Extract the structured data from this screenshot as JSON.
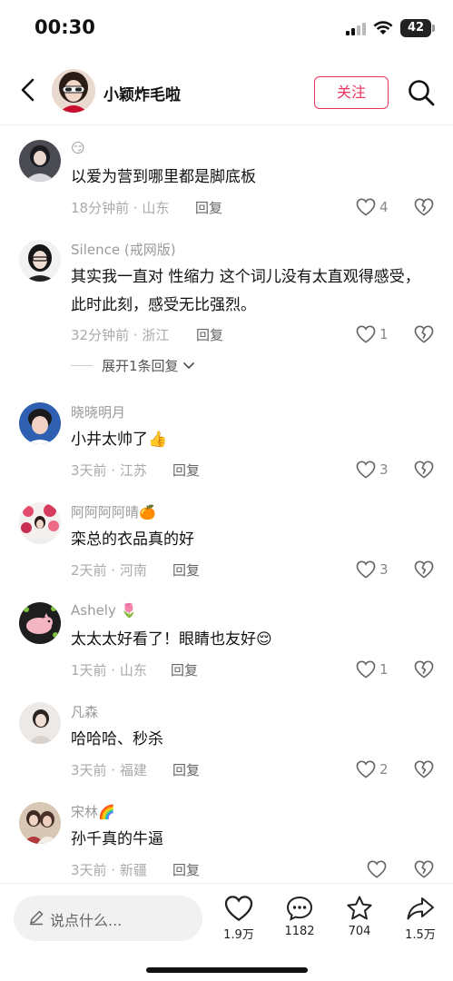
{
  "status_bar": {
    "time": "00:30",
    "battery": "42"
  },
  "header": {
    "user_name": "小颖炸毛啦",
    "follow_label": "关注"
  },
  "comments": [
    {
      "name": "",
      "name_emoji": "😏",
      "text": "以爱为营到哪里都是脚底板",
      "meta": "18分钟前 · 山东",
      "reply": "回复",
      "likes": "4"
    },
    {
      "name": "Silence (戒网版)",
      "text": "其实我一直对 性缩力 这个词儿没有太直观得感受，此时此刻，感受无比强烈。",
      "meta": "32分钟前 · 浙江",
      "reply": "回复",
      "likes": "1",
      "expand": "展开1条回复"
    },
    {
      "name": "晓晓明月",
      "text": "小井太帅了👍",
      "meta": "3天前 · 江苏",
      "reply": "回复",
      "likes": "3"
    },
    {
      "name": "阿阿阿阿晴🍊",
      "text": "栾总的衣品真的好",
      "meta": "2天前 · 河南",
      "reply": "回复",
      "likes": "3"
    },
    {
      "name": "Ashely 🌷",
      "text": "太太太好看了！眼睛也友好😌",
      "meta": "1天前 · 山东",
      "reply": "回复",
      "likes": "1"
    },
    {
      "name": "凡森",
      "text": "哈哈哈、秒杀",
      "meta": "3天前 · 福建",
      "reply": "回复",
      "likes": "2"
    },
    {
      "name": "宋林🌈",
      "text": "孙千真的牛逼",
      "meta": "3天前 · 新疆",
      "reply": "回复",
      "likes": ""
    }
  ],
  "bottom_bar": {
    "input_placeholder": "说点什么...",
    "like_count": "1.9万",
    "comment_count": "1182",
    "favorite_count": "704",
    "share_count": "1.5万"
  },
  "colors": {
    "accent": "#e8345d",
    "meta_gray": "#aaaaaa"
  }
}
